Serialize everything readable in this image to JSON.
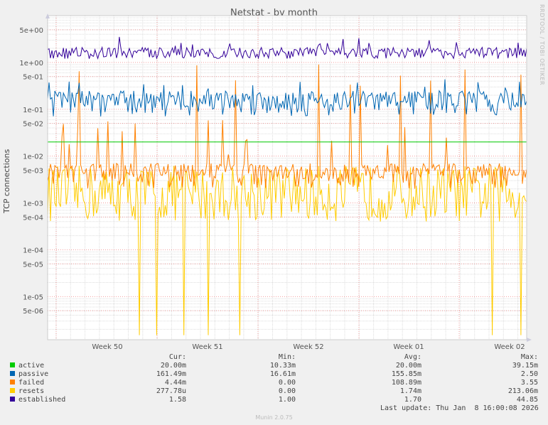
{
  "chart_data": {
    "type": "line",
    "title": "Netstat - by month",
    "ylabel": "TCP connections",
    "yscale": "log",
    "ylim": [
      1.2e-06,
      10
    ],
    "grid": true,
    "y_ticks": [
      "5e+00",
      "1e+00",
      "5e-01",
      "1e-01",
      "5e-02",
      "1e-02",
      "5e-03",
      "1e-03",
      "5e-04",
      "1e-04",
      "5e-05",
      "1e-05",
      "5e-06"
    ],
    "y_tick_values": [
      5,
      1,
      0.5,
      0.1,
      0.05,
      0.01,
      0.005,
      0.001,
      0.0005,
      0.0001,
      5e-05,
      1e-05,
      5e-06
    ],
    "x_ticks": [
      "Week 50",
      "Week 51",
      "Week 52",
      "Week 01",
      "Week 02"
    ],
    "legend_placement": "bottom",
    "legend_headers": {
      "cur": "Cur:",
      "min": "Min:",
      "avg": "Avg:",
      "max": "Max:"
    },
    "series": [
      {
        "name": "active",
        "color": "#00cc00",
        "cur": "20.00m",
        "min": "10.33m",
        "avg": "20.00m",
        "max": "39.15m",
        "typical": 0.02
      },
      {
        "name": "passive",
        "color": "#0066b3",
        "cur": "161.49m",
        "min": "16.61m",
        "avg": "155.85m",
        "max": "2.50",
        "typical": 0.14
      },
      {
        "name": "failed",
        "color": "#ff8000",
        "cur": "4.44m",
        "min": "0.00",
        "avg": "108.89m",
        "max": "3.55",
        "typical": 0.004
      },
      {
        "name": "resets",
        "color": "#ffcc00",
        "cur": "277.78u",
        "min": "0.00",
        "avg": "1.74m",
        "max": "213.06m",
        "typical": 0.0008
      },
      {
        "name": "established",
        "color": "#330099",
        "cur": "1.58",
        "min": "1.00",
        "avg": "1.70",
        "max": "44.85",
        "typical": 1.5
      }
    ]
  },
  "watermark": "RRDTOOL / TOBI OETIKER",
  "last_update": "Last update: Thu Jan  8 16:00:08 2026",
  "footer": "Munin 2.0.75"
}
